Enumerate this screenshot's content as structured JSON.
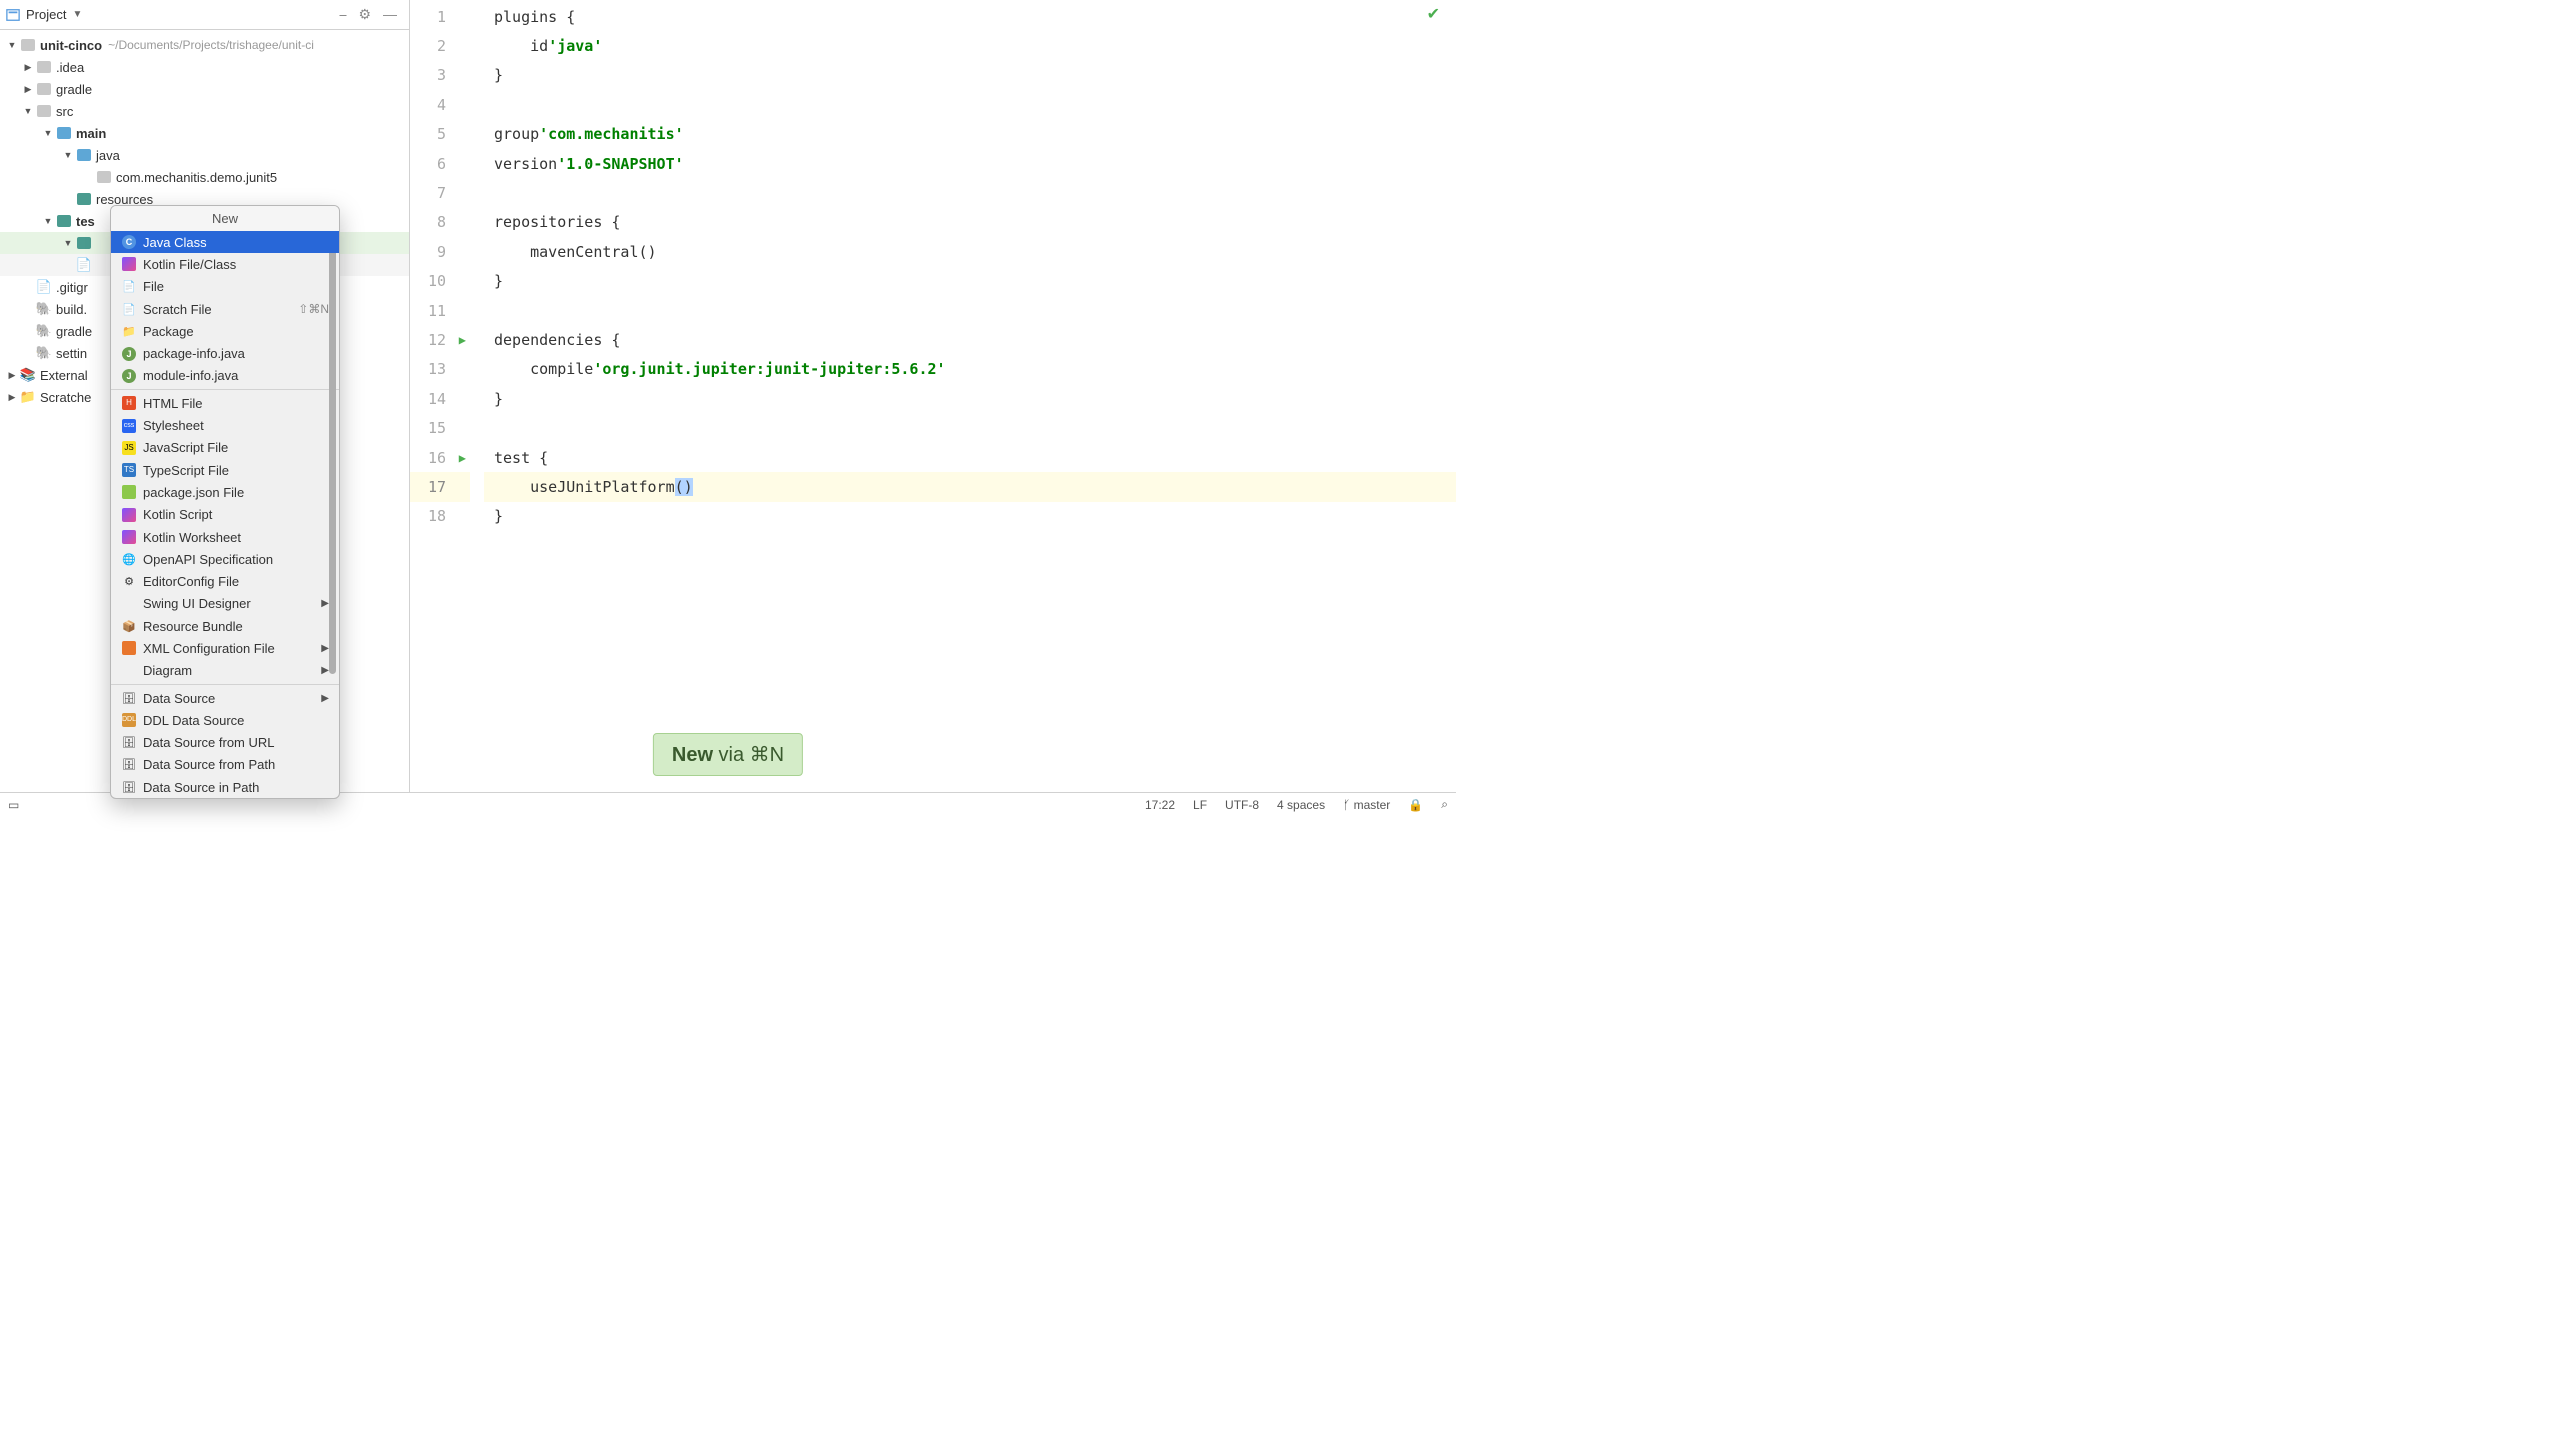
{
  "project_panel": {
    "header": "Project",
    "root": "unit-cinco",
    "root_path": "~/Documents/Projects/trishagee/unit-ci",
    "tree": {
      "idea": ".idea",
      "gradle": "gradle",
      "src": "src",
      "main": "main",
      "java": "java",
      "pkg": "com.mechanitis.demo.junit5",
      "resources": "resources",
      "test": "test",
      "gitignore": ".gitignore",
      "build": "build.gradle",
      "gradlew": "gradlew",
      "settings": "settings.gradle",
      "external": "External Libraries",
      "scratches": "Scratches and Consoles"
    }
  },
  "context_menu": {
    "title": "New",
    "items": [
      "Java Class",
      "Kotlin File/Class",
      "File",
      "Scratch File",
      "Package",
      "package-info.java",
      "module-info.java",
      "HTML File",
      "Stylesheet",
      "JavaScript File",
      "TypeScript File",
      "package.json File",
      "Kotlin Script",
      "Kotlin Worksheet",
      "OpenAPI Specification",
      "EditorConfig File",
      "Swing UI Designer",
      "Resource Bundle",
      "XML Configuration File",
      "Diagram",
      "Data Source",
      "DDL Data Source",
      "Data Source from URL",
      "Data Source from Path",
      "Data Source in Path"
    ],
    "scratch_shortcut": "⇧⌘N"
  },
  "editor": {
    "lines": [
      {
        "n": 1,
        "html": "plugins {"
      },
      {
        "n": 2,
        "html": "    id <span class='str'>'java'</span>"
      },
      {
        "n": 3,
        "html": "}"
      },
      {
        "n": 4,
        "html": ""
      },
      {
        "n": 5,
        "html": "group <span class='str'>'com.mechanitis'</span>"
      },
      {
        "n": 6,
        "html": "version <span class='str'>'1.0-SNAPSHOT'</span>"
      },
      {
        "n": 7,
        "html": ""
      },
      {
        "n": 8,
        "html": "repositories {"
      },
      {
        "n": 9,
        "html": "    mavenCentral()"
      },
      {
        "n": 10,
        "html": "}"
      },
      {
        "n": 11,
        "html": ""
      },
      {
        "n": 12,
        "html": "dependencies {",
        "run": true
      },
      {
        "n": 13,
        "html": "    compile <span class='str'>'org.junit.jupiter:junit-jupiter:5.6.2'</span>"
      },
      {
        "n": 14,
        "html": "}"
      },
      {
        "n": 15,
        "html": ""
      },
      {
        "n": 16,
        "html": "test {",
        "run": true
      },
      {
        "n": 17,
        "html": "    useJUnitPlatform<span class='hl-paren'>()</span>",
        "cur": true
      },
      {
        "n": 18,
        "html": "}"
      }
    ]
  },
  "status_bar": {
    "time": "17:22",
    "lf": "LF",
    "enc": "UTF-8",
    "indent": "4 spaces",
    "branch": "master"
  },
  "popup": {
    "action": "New",
    "via": " via ⌘N"
  }
}
